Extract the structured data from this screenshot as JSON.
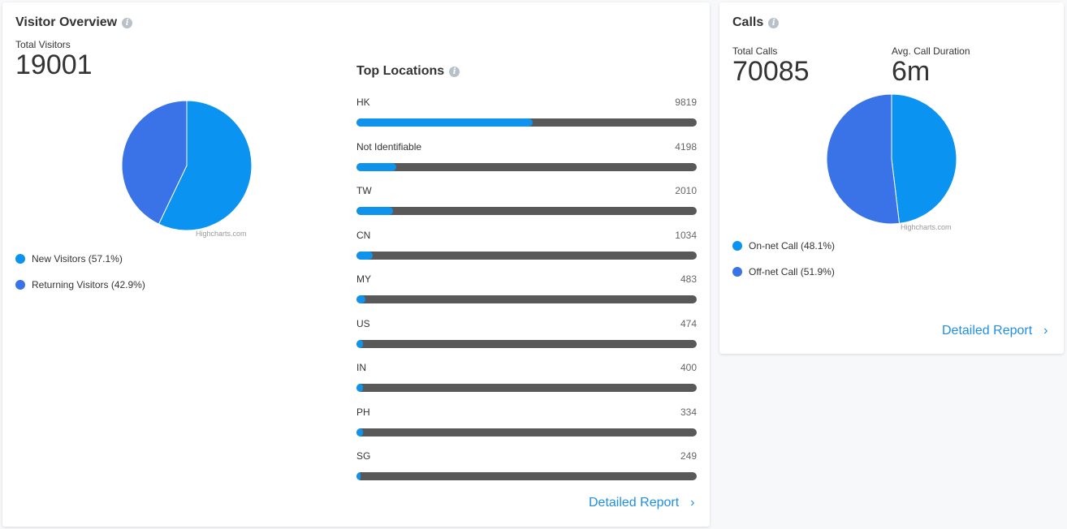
{
  "visitor_overview": {
    "title": "Visitor Overview",
    "total_label": "Total Visitors",
    "total_value": "19001",
    "credits": "Highcharts.com",
    "legend": [
      {
        "label": "New Visitors (57.1%)",
        "color": "#0a93f0"
      },
      {
        "label": "Returning Visitors (42.9%)",
        "color": "#3a72e8"
      }
    ]
  },
  "top_locations": {
    "title": "Top Locations",
    "max": 19001,
    "items": [
      {
        "name": "HK",
        "value": "9819",
        "fill": 0.517
      },
      {
        "name": "Not Identifiable",
        "value": "4198",
        "fill": 0.118
      },
      {
        "name": "TW",
        "value": "2010",
        "fill": 0.108
      },
      {
        "name": "CN",
        "value": "1034",
        "fill": 0.048
      },
      {
        "name": "MY",
        "value": "483",
        "fill": 0.027
      },
      {
        "name": "US",
        "value": "474",
        "fill": 0.02
      },
      {
        "name": "IN",
        "value": "400",
        "fill": 0.02
      },
      {
        "name": "PH",
        "value": "334",
        "fill": 0.02
      },
      {
        "name": "SG",
        "value": "249",
        "fill": 0.013
      }
    ],
    "report_link": "Detailed Report"
  },
  "calls": {
    "title": "Calls",
    "total_label": "Total Calls",
    "total_value": "70085",
    "duration_label": "Avg. Call Duration",
    "duration_value": "6m",
    "credits": "Highcharts.com",
    "legend": [
      {
        "label": "On-net Call (48.1%)",
        "color": "#0a93f0"
      },
      {
        "label": "Off-net Call (51.9%)",
        "color": "#3a72e8"
      }
    ],
    "report_link": "Detailed Report"
  },
  "chart_data": [
    {
      "type": "pie",
      "title": "",
      "series": [
        {
          "name": "",
          "values": [
            57.1,
            42.9
          ]
        }
      ],
      "categories": [
        "New Visitors",
        "Returning Visitors"
      ],
      "colors": [
        "#0a93f0",
        "#3a72e8"
      ]
    },
    {
      "type": "pie",
      "title": "",
      "series": [
        {
          "name": "",
          "values": [
            48.1,
            51.9
          ]
        }
      ],
      "categories": [
        "On-net Call",
        "Off-net Call"
      ],
      "colors": [
        "#0a93f0",
        "#3a72e8"
      ]
    }
  ]
}
